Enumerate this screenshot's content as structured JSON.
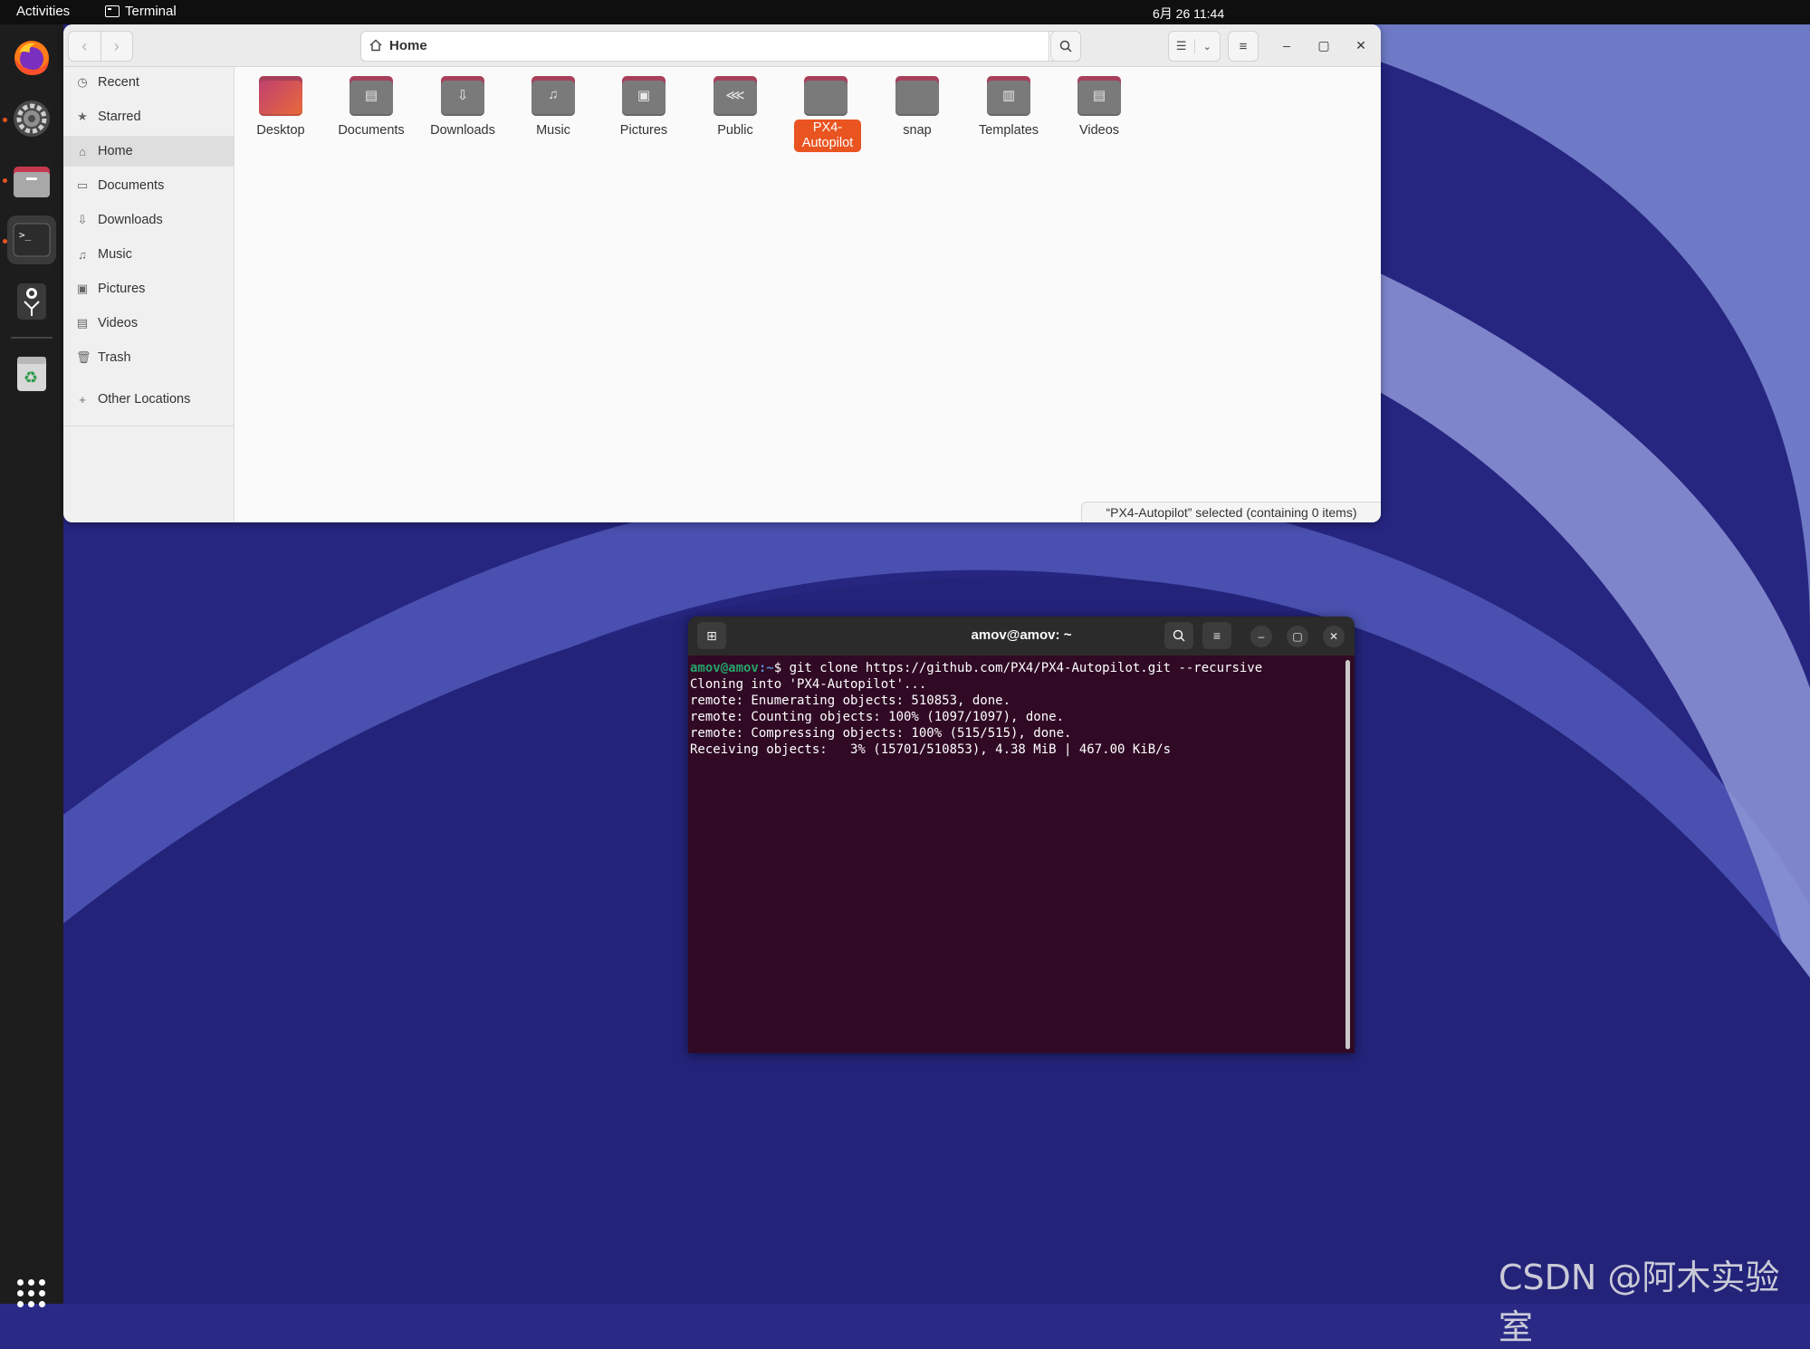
{
  "topbar": {
    "activities": "Activities",
    "app_name": "Terminal",
    "clock": "6月 26  11:44"
  },
  "dock": {
    "items": [
      "firefox-icon",
      "settings-icon",
      "files-icon",
      "terminal-icon",
      "inkscape-icon",
      "trash-icon"
    ],
    "apps_button": "show-apps-icon"
  },
  "files": {
    "path_label": "Home",
    "sidebar": [
      {
        "label": "Recent",
        "icon": "clock-icon"
      },
      {
        "label": "Starred",
        "icon": "star-icon"
      },
      {
        "label": "Home",
        "icon": "home-icon"
      },
      {
        "label": "Documents",
        "icon": "document-icon"
      },
      {
        "label": "Downloads",
        "icon": "download-icon"
      },
      {
        "label": "Music",
        "icon": "music-icon"
      },
      {
        "label": "Pictures",
        "icon": "picture-icon"
      },
      {
        "label": "Videos",
        "icon": "video-icon"
      },
      {
        "label": "Trash",
        "icon": "trash-icon"
      },
      {
        "label": "Other Locations",
        "icon": "plus-icon"
      }
    ],
    "folders": [
      {
        "name": "Desktop"
      },
      {
        "name": "Documents"
      },
      {
        "name": "Downloads"
      },
      {
        "name": "Music"
      },
      {
        "name": "Pictures"
      },
      {
        "name": "Public"
      },
      {
        "name": "PX4-Autopilot"
      },
      {
        "name": "snap"
      },
      {
        "name": "Templates"
      },
      {
        "name": "Videos"
      }
    ],
    "status": "“PX4-Autopilot” selected  (containing 0 items)"
  },
  "terminal": {
    "title": "amov@amov: ~",
    "prompt_user": "amov@amov",
    "prompt_path": ":~",
    "prompt_end": "$ ",
    "command": "git clone https://github.com/PX4/PX4-Autopilot.git --recursive",
    "lines": [
      "Cloning into 'PX4-Autopilot'...",
      "remote: Enumerating objects: 510853, done.",
      "remote: Counting objects: 100% (1097/1097), done.",
      "remote: Compressing objects: 100% (515/515), done.",
      "Receiving objects:   3% (15701/510853), 4.38 MiB | 467.00 KiB/s"
    ]
  },
  "watermark": "CSDN @阿木实验室",
  "colors": {
    "accent": "#e95420",
    "terminal_bg": "#300a24",
    "wallpaper": "#2a2a86"
  }
}
